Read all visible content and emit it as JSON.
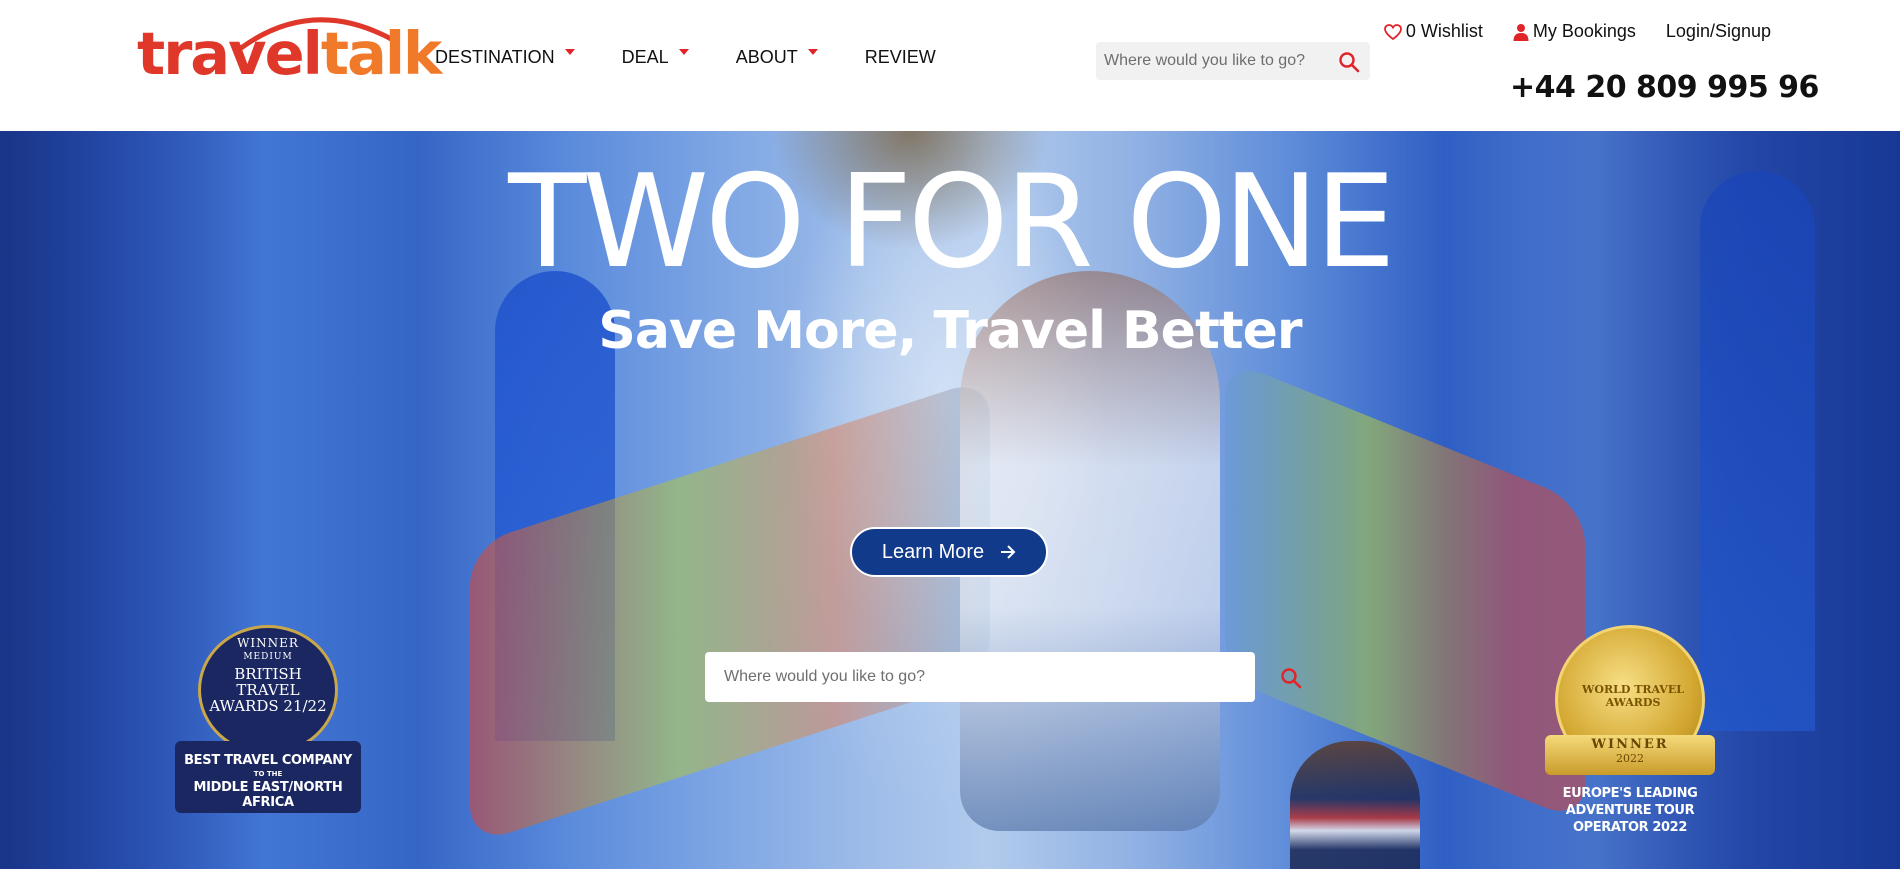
{
  "brand": {
    "logo_text_a": "travel",
    "logo_text_b": "talk",
    "primary_color": "#e0372b",
    "accent_color": "#f07a2a"
  },
  "nav": {
    "items": [
      {
        "label": "DESTINATION",
        "has_dropdown": true
      },
      {
        "label": "DEAL",
        "has_dropdown": true
      },
      {
        "label": "ABOUT",
        "has_dropdown": true
      },
      {
        "label": "REVIEW",
        "has_dropdown": false
      }
    ]
  },
  "header_search": {
    "placeholder": "Where would you like to go?",
    "icon": "search-icon"
  },
  "utility": {
    "wishlist_label": "0 Wishlist",
    "wishlist_icon": "heart-icon",
    "bookings_label": "My Bookings",
    "bookings_icon": "user-icon",
    "login_label": "Login/Signup",
    "phone": "+44 20 809 995 96"
  },
  "hero": {
    "title": "TWO FOR ONE",
    "subtitle": "Save More, Travel Better",
    "cta_label": "Learn More",
    "cta_icon": "arrow-right-icon",
    "search_placeholder": "Where would you like to go?"
  },
  "badges": {
    "left": {
      "winner": "WINNER",
      "medium": "MEDIUM",
      "title": "BRITISH TRAVEL AWARDS 21/22",
      "line1": "BEST TRAVEL COMPANY",
      "line2": "TO THE",
      "line3": "MIDDLE EAST/NORTH AFRICA"
    },
    "right": {
      "seal": "WORLD TRAVEL AWARDS",
      "winner": "WINNER",
      "year": "2022",
      "caption": "EUROPE'S LEADING ADVENTURE TOUR OPERATOR 2022"
    }
  }
}
